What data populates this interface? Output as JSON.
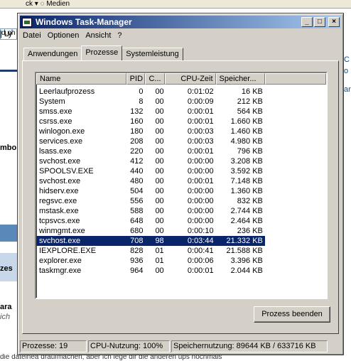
{
  "background": {
    "top_bar_text": "ck ▾ ◌ Medien",
    "url_fragment": "d.ph",
    "left_texts": [
      "| Ly",
      "mbo",
      "zes",
      "ara",
      "ich"
    ],
    "right_texts": [
      "C",
      "o",
      "ar"
    ],
    "bottom_text": "die dateinea draufmachen, aber ich lege dir die anderen ups nochmals"
  },
  "window": {
    "title": "Windows Task-Manager",
    "min_label": "_",
    "max_label": "□",
    "close_label": "×"
  },
  "menu": [
    "Datei",
    "Optionen",
    "Ansicht",
    "?"
  ],
  "tabs": [
    {
      "label": "Anwendungen",
      "active": false
    },
    {
      "label": "Prozesse",
      "active": true
    },
    {
      "label": "Systemleistung",
      "active": false
    }
  ],
  "table": {
    "headers": [
      "Name",
      "PID",
      "C...",
      "CPU-Zeit",
      "Speicher..."
    ],
    "rows": [
      [
        "Leerlaufprozess",
        "0",
        "00",
        "0:01:02",
        "16 KB"
      ],
      [
        "System",
        "8",
        "00",
        "0:00:09",
        "212 KB"
      ],
      [
        "smss.exe",
        "132",
        "00",
        "0:00:01",
        "564 KB"
      ],
      [
        "csrss.exe",
        "160",
        "00",
        "0:00:01",
        "1.660 KB"
      ],
      [
        "winlogon.exe",
        "180",
        "00",
        "0:00:03",
        "1.460 KB"
      ],
      [
        "services.exe",
        "208",
        "00",
        "0:00:03",
        "4.980 KB"
      ],
      [
        "lsass.exe",
        "220",
        "00",
        "0:00:01",
        "796 KB"
      ],
      [
        "svchost.exe",
        "412",
        "00",
        "0:00:00",
        "3.208 KB"
      ],
      [
        "SPOOLSV.EXE",
        "440",
        "00",
        "0:00:00",
        "3.592 KB"
      ],
      [
        "svchost.exe",
        "480",
        "00",
        "0:00:01",
        "7.148 KB"
      ],
      [
        "hidserv.exe",
        "504",
        "00",
        "0:00:00",
        "1.360 KB"
      ],
      [
        "regsvc.exe",
        "556",
        "00",
        "0:00:00",
        "832 KB"
      ],
      [
        "mstask.exe",
        "588",
        "00",
        "0:00:00",
        "2.744 KB"
      ],
      [
        "tcpsvcs.exe",
        "648",
        "00",
        "0:00:00",
        "2.464 KB"
      ],
      [
        "winmgmt.exe",
        "680",
        "00",
        "0:00:10",
        "236 KB"
      ],
      [
        "svchost.exe",
        "708",
        "98",
        "0:03:44",
        "21.332 KB"
      ],
      [
        "IEXPLORE.EXE",
        "828",
        "01",
        "0:00:41",
        "21.588 KB"
      ],
      [
        "explorer.exe",
        "936",
        "01",
        "0:00:06",
        "3.396 KB"
      ],
      [
        "taskmgr.exe",
        "964",
        "00",
        "0:00:01",
        "2.044 KB"
      ]
    ],
    "selected_index": 15
  },
  "end_button_label": "Prozess beenden",
  "status": {
    "processes": "Prozesse: 19",
    "cpu": "CPU-Nutzung: 100%",
    "memory": "Speichernutzung: 89644 KB / 633716 KB"
  },
  "colors": {
    "title_start": "#0a246a",
    "title_end": "#a6caf0",
    "selection": "#0a246a",
    "face": "#d4d0c8"
  }
}
